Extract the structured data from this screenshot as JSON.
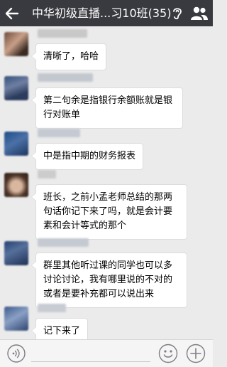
{
  "header": {
    "title": "中华初级直播...习10班(35)",
    "back_icon": "arrow-left-icon",
    "listen_icon": "ear-icon",
    "members_icon": "group-people-icon",
    "background": "#393a3f"
  },
  "messages": [
    {
      "text": "清晰了，哈哈"
    },
    {
      "text": "第二句余是指银行余额账就是银行对账单"
    },
    {
      "text": "中是指中期的财务报表"
    },
    {
      "text": "班长，之前小孟老师总结的那两句话你记下来了吗，就是会计要素和会计等式的那个"
    },
    {
      "text": "群里其他听过课的同学也可以多讨论讨论，我有哪里说的不对的或者是要补充都可以说出来"
    },
    {
      "text": "记下来了"
    }
  ],
  "input_bar": {
    "voice_icon": "voice-wave-icon",
    "emoji_icon": "smiley-icon",
    "plus_icon": "plus-icon"
  },
  "colors": {
    "chat_background": "#ebebeb",
    "bubble": "#ffffff"
  }
}
